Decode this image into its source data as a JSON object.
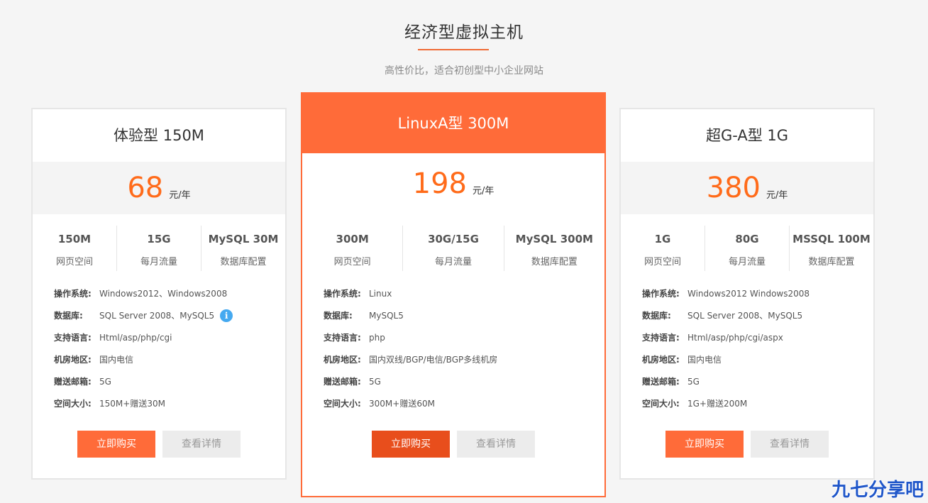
{
  "header": {
    "title": "经济型虚拟主机",
    "subtitle": "高性价比，适合初创型中小企业网站"
  },
  "plans": [
    {
      "name": "体验型 150M",
      "price": "68",
      "unit": "元/年",
      "specs": [
        {
          "value": "150M",
          "label": "网页空间"
        },
        {
          "value": "15G",
          "label": "每月流量"
        },
        {
          "value": "MySQL 30M",
          "label": "数据库配置"
        }
      ],
      "details": [
        {
          "label": "操作系统:",
          "value": "Windows2012、Windows2008"
        },
        {
          "label": "数据库:",
          "value": "SQL Server 2008、MySQL5"
        },
        {
          "label": "支持语言:",
          "value": "Html/asp/php/cgi"
        },
        {
          "label": "机房地区:",
          "value": "国内电信"
        },
        {
          "label": "赠送邮箱:",
          "value": "5G"
        },
        {
          "label": "空间大小:",
          "value": "150M+赠送30M"
        }
      ],
      "buy_label": "立即购买",
      "detail_label": "查看详情"
    },
    {
      "name": "LinuxA型 300M",
      "price": "198",
      "unit": "元/年",
      "specs": [
        {
          "value": "300M",
          "label": "网页空间"
        },
        {
          "value": "30G/15G",
          "label": "每月流量"
        },
        {
          "value": "MySQL 300M",
          "label": "数据库配置"
        }
      ],
      "details": [
        {
          "label": "操作系统:",
          "value": "Linux"
        },
        {
          "label": "数据库:",
          "value": "MySQL5"
        },
        {
          "label": "支持语言:",
          "value": "php"
        },
        {
          "label": "机房地区:",
          "value": "国内双线/BGP/电信/BGP多线机房"
        },
        {
          "label": "赠送邮箱:",
          "value": "5G"
        },
        {
          "label": "空间大小:",
          "value": "300M+赠送60M"
        }
      ],
      "buy_label": "立即购买",
      "detail_label": "查看详情"
    },
    {
      "name": "超G-A型 1G",
      "price": "380",
      "unit": "元/年",
      "specs": [
        {
          "value": "1G",
          "label": "网页空间"
        },
        {
          "value": "80G",
          "label": "每月流量"
        },
        {
          "value": "MSSQL 100M",
          "label": "数据库配置"
        }
      ],
      "details": [
        {
          "label": "操作系统:",
          "value": "Windows2012 Windows2008"
        },
        {
          "label": "数据库:",
          "value": "SQL Server 2008、MySQL5"
        },
        {
          "label": "支持语言:",
          "value": "Html/asp/php/cgi/aspx"
        },
        {
          "label": "机房地区:",
          "value": "国内电信"
        },
        {
          "label": "赠送邮箱:",
          "value": "5G"
        },
        {
          "label": "空间大小:",
          "value": "1G+赠送200M"
        }
      ],
      "buy_label": "立即购买",
      "detail_label": "查看详情"
    }
  ],
  "info_icon_glyph": "i",
  "watermark": "九七分享吧",
  "colors": {
    "accent": "#ff6b39",
    "price": "#ff6b1a",
    "info": "#45a9f0",
    "watermark": "#1f56c9"
  }
}
